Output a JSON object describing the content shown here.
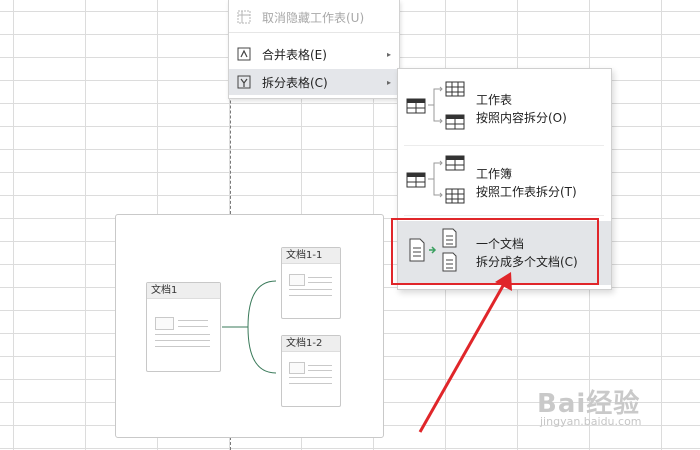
{
  "context_menu": {
    "items": [
      {
        "label": "取消隐藏工作表(U)",
        "enabled": false
      },
      {
        "label": "合并表格(E)",
        "has_submenu": true
      },
      {
        "label": "拆分表格(C)",
        "has_submenu": true,
        "active": true
      }
    ],
    "arrow_glyph": "▸"
  },
  "submenu": {
    "items": [
      {
        "title": "工作表",
        "desc": "按照内容拆分(O)"
      },
      {
        "title": "工作簿",
        "desc": "按照工作表拆分(T)"
      },
      {
        "title": "一个文档",
        "desc": "拆分成多个文档(C)",
        "highlighted": true
      }
    ]
  },
  "preview": {
    "source_doc": "文档1",
    "result_docs": [
      "文档1-1",
      "文档1-2"
    ]
  },
  "watermark": {
    "brand": "Bai经验",
    "url": "jingyan.baidu.com"
  },
  "colors": {
    "highlight_border": "#e0262a",
    "annotation_arrow": "#e0262a",
    "connector": "#3a7a5a"
  }
}
